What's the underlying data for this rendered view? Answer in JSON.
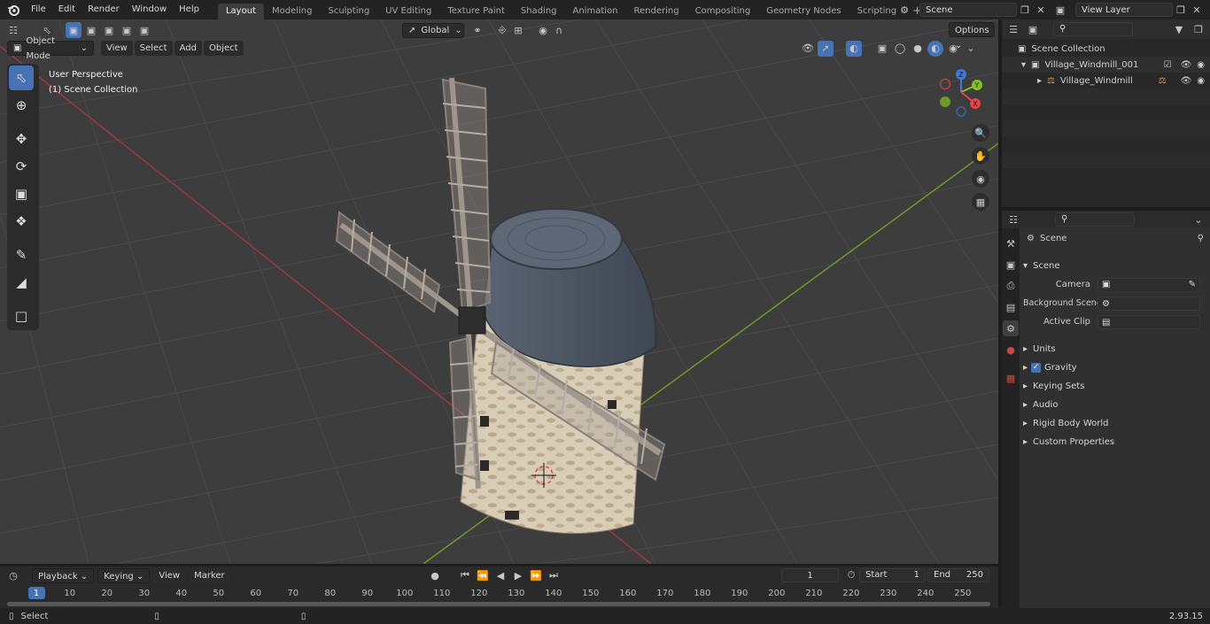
{
  "menubar": {
    "items": [
      "File",
      "Edit",
      "Render",
      "Window",
      "Help"
    ],
    "workspaces": [
      "Layout",
      "Modeling",
      "Sculpting",
      "UV Editing",
      "Texture Paint",
      "Shading",
      "Animation",
      "Rendering",
      "Compositing",
      "Geometry Nodes",
      "Scripting"
    ],
    "active_workspace": "Layout",
    "scene_name": "Scene",
    "view_layer": "View Layer"
  },
  "viewport": {
    "mode": "Object Mode",
    "menus": [
      "View",
      "Select",
      "Add",
      "Object"
    ],
    "transform_orientation": "Global",
    "options_label": "Options",
    "overlay_line1": "User Perspective",
    "overlay_line2": "(1) Scene Collection",
    "gizmo_axes": {
      "z": "Z",
      "y": "Y",
      "x": "X"
    }
  },
  "outliner": {
    "root": "Scene Collection",
    "collection": "Village_Windmill_001",
    "object": "Village_Windmill"
  },
  "properties": {
    "tab_title": "Scene",
    "panel_title": "Scene",
    "camera_label": "Camera",
    "background_scene_label": "Background Scene",
    "active_clip_label": "Active Clip",
    "sections": [
      "Units",
      "Gravity",
      "Keying Sets",
      "Audio",
      "Rigid Body World",
      "Custom Properties"
    ],
    "gravity_checked": true
  },
  "timeline": {
    "menus": [
      "Playback",
      "Keying",
      "View",
      "Marker"
    ],
    "current_frame": "1",
    "start_label": "Start",
    "start_value": "1",
    "end_label": "End",
    "end_value": "250",
    "ruler": [
      "1",
      "10",
      "20",
      "30",
      "40",
      "50",
      "60",
      "70",
      "80",
      "90",
      "100",
      "110",
      "120",
      "130",
      "140",
      "150",
      "160",
      "170",
      "180",
      "190",
      "200",
      "210",
      "220",
      "230",
      "240",
      "250"
    ]
  },
  "statusbar": {
    "left": "Select",
    "version": "2.93.15"
  },
  "colors": {
    "accent": "#4772b3",
    "x_axis": "#e8434b",
    "y_axis": "#83c227",
    "z_axis": "#3f7ad6"
  }
}
